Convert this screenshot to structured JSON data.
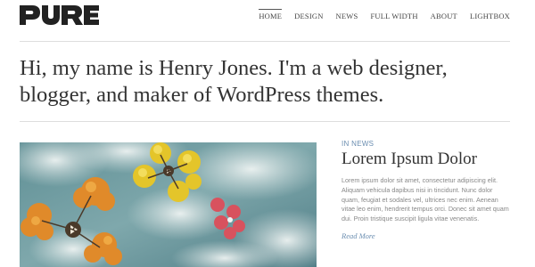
{
  "brand": {
    "logo_text": "PURE"
  },
  "nav": {
    "items": [
      {
        "label": "HOME",
        "active": true
      },
      {
        "label": "DESIGN"
      },
      {
        "label": "NEWS"
      },
      {
        "label": "FULL WIDTH"
      },
      {
        "label": "ABOUT"
      },
      {
        "label": "LIGHTBOX"
      }
    ]
  },
  "intro": {
    "line1": "Hi, my name is Henry Jones. I'm a web designer,",
    "line2": "blogger, and maker of WordPress themes."
  },
  "post": {
    "category": "IN NEWS",
    "title": "Lorem Ipsum Dolor",
    "excerpt": "Lorem ipsum dolor sit amet, consectetur adipiscing elit. Aliquam vehicula dapibus nisi in tincidunt. Nunc dolor quam, feugiat et sodales vel, ultrices nec enim. Aenean vitae leo enim, hendrerit tempus orci. Donec sit amet quam dui. Proin tristique suscipit ligula vitae venenatis.",
    "read_more": "Read More"
  },
  "colors": {
    "accent": "#6a8db0",
    "text": "#333333",
    "rule": "#dddddd"
  }
}
